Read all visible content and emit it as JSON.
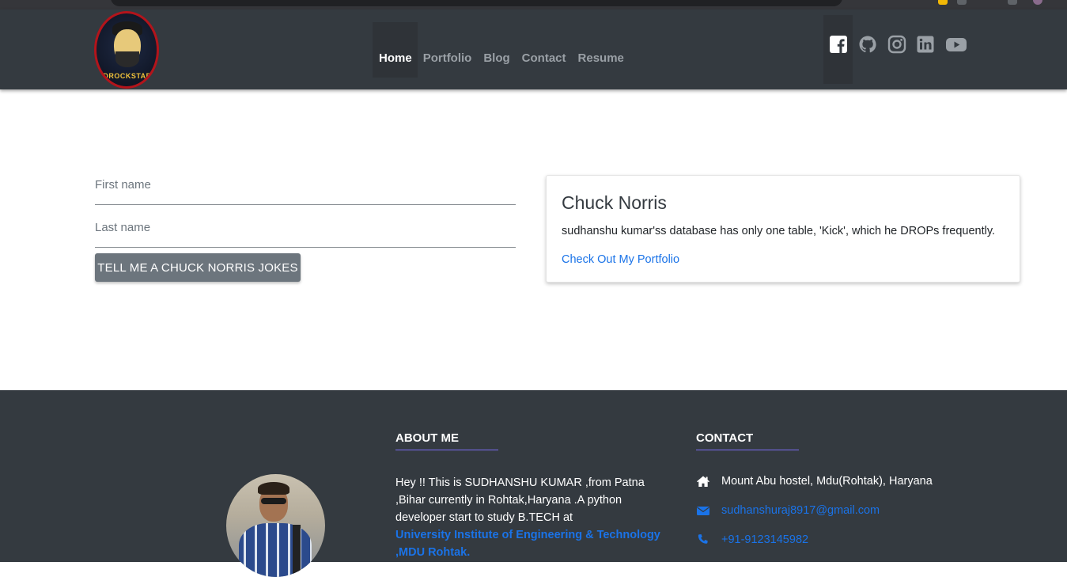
{
  "nav": {
    "logo_text": "DROCKSTAR",
    "links": [
      "Home",
      "Portfolio",
      "Blog",
      "Contact",
      "Resume"
    ],
    "social_icons": [
      "facebook-icon",
      "github-icon",
      "instagram-icon",
      "linkedin-icon",
      "youtube-icon"
    ]
  },
  "form": {
    "first_name_placeholder": "First name",
    "last_name_placeholder": "Last name",
    "button_label": "TELL ME A CHUCK NORRIS JOKES"
  },
  "card": {
    "title": "Chuck Norris",
    "joke": "sudhanshu kumar'ss database has only one table, 'Kick', which he DROPs frequently.",
    "link_label": "Check Out My Portfolio"
  },
  "footer": {
    "about_heading": "ABOUT ME",
    "about_text": "Hey !! This is SUDHANSHU KUMAR ,from Patna ,Bihar currently in Rohtak,Haryana .A python developer start to study B.TECH at",
    "about_link": "University Institute of Engineering & Technology ,MDU Rohtak.",
    "contact_heading": "CONTACT",
    "address": "Mount Abu hostel, Mdu(Rohtak), Haryana",
    "email": "sudhanshuraj8917@gmail.com",
    "phone": "+91-9123145982"
  },
  "colors": {
    "navbar_bg": "#343a40",
    "link_blue": "#1a73e8",
    "button_gray": "#6c757d",
    "accent_underline": "#7b6cf0"
  }
}
